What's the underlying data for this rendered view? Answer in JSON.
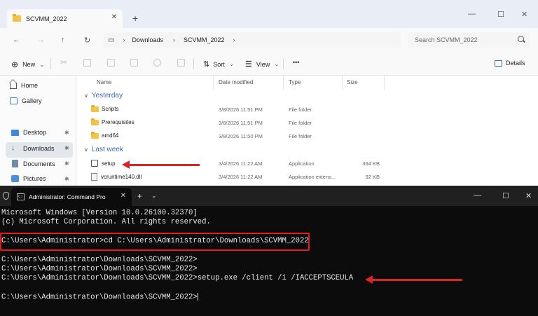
{
  "explorer": {
    "tab_title": "SCVMM_2022",
    "tab_close": "✕",
    "tab_add": "+",
    "window_controls": [
      "—",
      "☐",
      "✕"
    ],
    "nav": {
      "back": "←",
      "forward": "→",
      "up": "↑",
      "refresh": "↻",
      "monitor_icon": "▭",
      "chevron": "›"
    },
    "breadcrumb": [
      "Downloads",
      "SCVMM_2022"
    ],
    "search_placeholder": "Search SCVMM_2022",
    "toolbar": {
      "new_label": "New",
      "new_glyph": "⊕",
      "new_caret": "⌄",
      "sort_label": "Sort",
      "sort_caret": "⌄",
      "view_label": "View",
      "view_caret": "⌄",
      "more_label": "•••",
      "details_label": "Details"
    },
    "sidebar": {
      "items": [
        {
          "label": "Home",
          "icon": "home-icon"
        },
        {
          "label": "Gallery",
          "icon": "gallery-icon"
        },
        {
          "label": "Desktop",
          "icon": "desktop-icon",
          "pinned": true
        },
        {
          "label": "Downloads",
          "icon": "download-icon",
          "pinned": true,
          "selected": true
        },
        {
          "label": "Documents",
          "icon": "documents-icon",
          "pinned": true
        },
        {
          "label": "Pictures",
          "icon": "pictures-icon",
          "pinned": true
        }
      ],
      "pin_glyph": "✱"
    },
    "columns": [
      "Name",
      "Date modified",
      "Type",
      "Size"
    ],
    "groups": [
      "Yesterday",
      "Last week"
    ],
    "files": [
      {
        "name": "Scripts",
        "date": "3/8/2026 11:51 PM",
        "type": "File folder",
        "size": ""
      },
      {
        "name": "Prerequisites",
        "date": "3/8/2026 11:51 PM",
        "type": "File folder",
        "size": ""
      },
      {
        "name": "amd64",
        "date": "3/8/2026 11:50 PM",
        "type": "File folder",
        "size": ""
      },
      {
        "name": "setup",
        "date": "3/4/2026 11:22 AM",
        "type": "Application",
        "size": "364 KB"
      },
      {
        "name": "vcruntime140.dll",
        "date": "3/4/2026 11:22 AM",
        "type": "Application extens...",
        "size": "92 KB"
      }
    ]
  },
  "terminal": {
    "tab_title": "Administrator: Command Pro",
    "tab_close": "✕",
    "tab_add": "+",
    "tab_dropdown": "⌄",
    "window_controls": [
      "—",
      "☐",
      "✕"
    ],
    "cmd_icon_text": "C:\\",
    "lines": [
      "Microsoft Windows [Version 10.0.26100.32370]",
      "(c) Microsoft Corporation. All rights reserved.",
      "C:\\Users\\Administrator>cd C:\\Users\\Administrator\\Downloads\\SCVMM_2022",
      "C:\\Users\\Administrator\\Downloads\\SCVMM_2022>",
      "C:\\Users\\Administrator\\Downloads\\SCVMM_2022>",
      "C:\\Users\\Administrator\\Downloads\\SCVMM_2022>setup.exe /client /i /IACCEPTSCEULA",
      "C:\\Users\\Administrator\\Downloads\\SCVMM_2022>"
    ]
  },
  "annotation_color": "#d92525"
}
